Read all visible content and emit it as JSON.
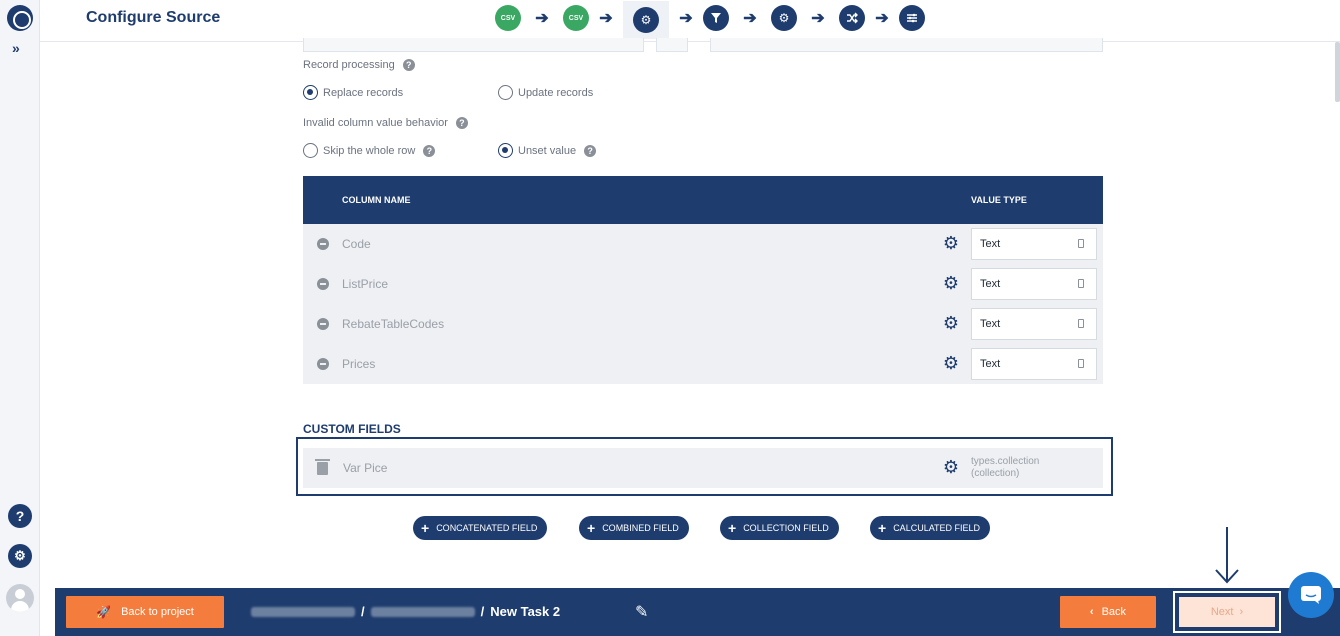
{
  "header": {
    "title": "Configure Source",
    "steps": [
      {
        "icon": "csv-badge",
        "label": "CSV"
      },
      {
        "icon": "csv-badge",
        "label": "CSV"
      },
      {
        "icon": "gear-icon",
        "label": ""
      },
      {
        "icon": "filter-icon",
        "label": ""
      },
      {
        "icon": "gear-icon",
        "label": ""
      },
      {
        "icon": "shuffle-icon",
        "label": ""
      },
      {
        "icon": "sliders-icon",
        "label": ""
      }
    ]
  },
  "sidebar": {
    "expand": "»",
    "help": "?",
    "settings": "⚙"
  },
  "form": {
    "record_processing_label": "Record processing",
    "replace_records": "Replace records",
    "update_records": "Update records",
    "invalid_behavior_label": "Invalid column value behavior",
    "skip_row": "Skip the whole row",
    "unset_value": "Unset value",
    "help_glyph": "?"
  },
  "table": {
    "col_name_header": "COLUMN NAME",
    "value_type_header": "VALUE TYPE",
    "rows": [
      {
        "name": "Code",
        "type": "Text"
      },
      {
        "name": "ListPrice",
        "type": "Text"
      },
      {
        "name": "RebateTableCodes",
        "type": "Text"
      },
      {
        "name": "Prices",
        "type": "Text"
      }
    ]
  },
  "custom_fields": {
    "title": "CUSTOM FIELDS",
    "rows": [
      {
        "name": "Var Pice",
        "type_line1": "types.collection",
        "type_line2": "(collection)"
      }
    ]
  },
  "add_buttons": {
    "concatenated": "CONCATENATED FIELD",
    "combined": "COMBINED FIELD",
    "collection": "COLLECTION FIELD",
    "calculated": "CALCULATED FIELD"
  },
  "footer": {
    "back_to_project": "Back to project",
    "breadcrumb_sep": "/",
    "task_name": "New Task 2",
    "back": "Back",
    "next": "Next"
  },
  "colors": {
    "brand_navy": "#1e3c6e",
    "accent_orange": "#f47c3c",
    "csv_green": "#3aa863",
    "chat_blue": "#1f7bd2"
  }
}
